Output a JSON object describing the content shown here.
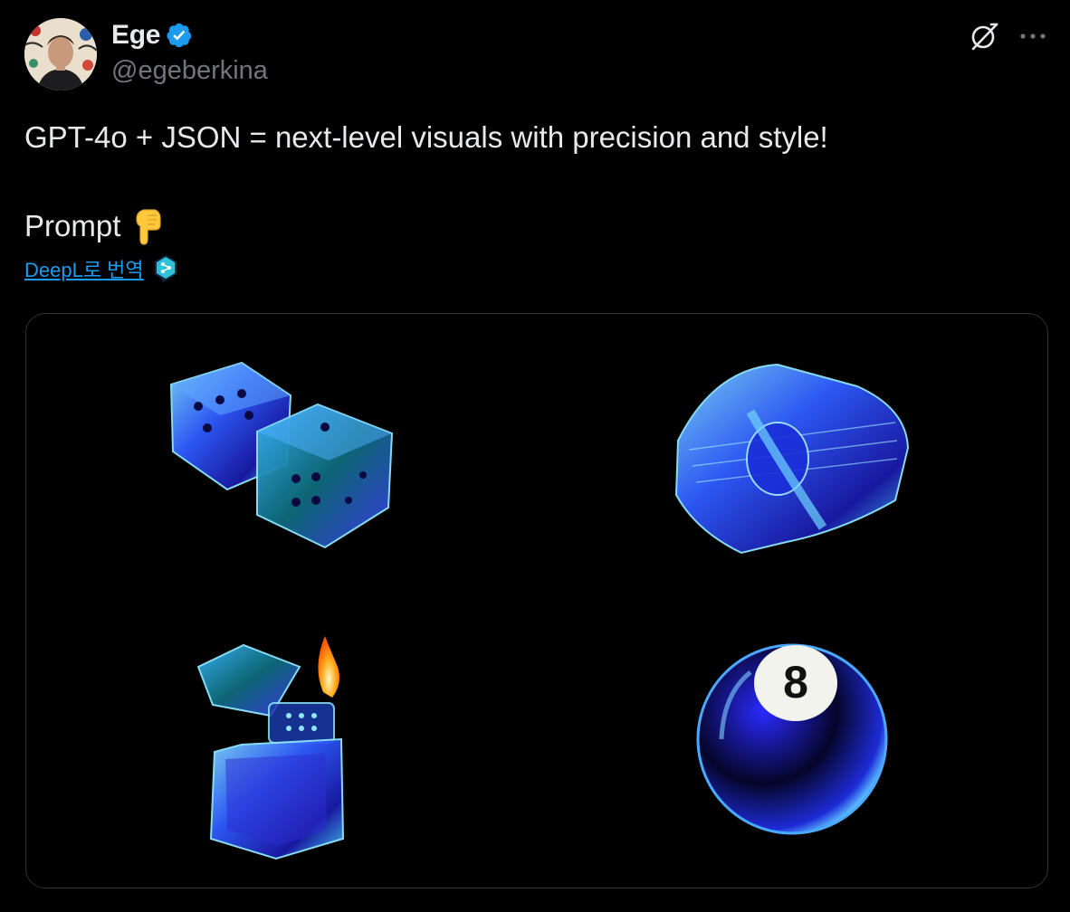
{
  "author": {
    "display_name": "Ege",
    "handle": "@egeberkina",
    "verified": true
  },
  "tweet": {
    "text_line1": "GPT-4o + JSON = next-level visuals with precision and style!",
    "text_line2": "Prompt",
    "text_line2_emoji": "pointing-down-emoji",
    "translate_label": "DeepL로 번역"
  },
  "icons": {
    "verified": "verified-badge-icon",
    "grok": "grok-icon",
    "more": "more-options-icon",
    "deepl": "deepl-icon"
  },
  "media": {
    "images": [
      {
        "name": "glass-dice-image"
      },
      {
        "name": "glass-money-roll-image"
      },
      {
        "name": "glass-lighter-image"
      },
      {
        "name": "glass-8-ball-image"
      }
    ],
    "eight_ball_number": "8"
  },
  "colors": {
    "background": "#000000",
    "text": "#e7e9ea",
    "secondary_text": "#71767b",
    "link": "#1d9bf0",
    "verified": "#1d9bf0",
    "border": "#2f3336"
  }
}
